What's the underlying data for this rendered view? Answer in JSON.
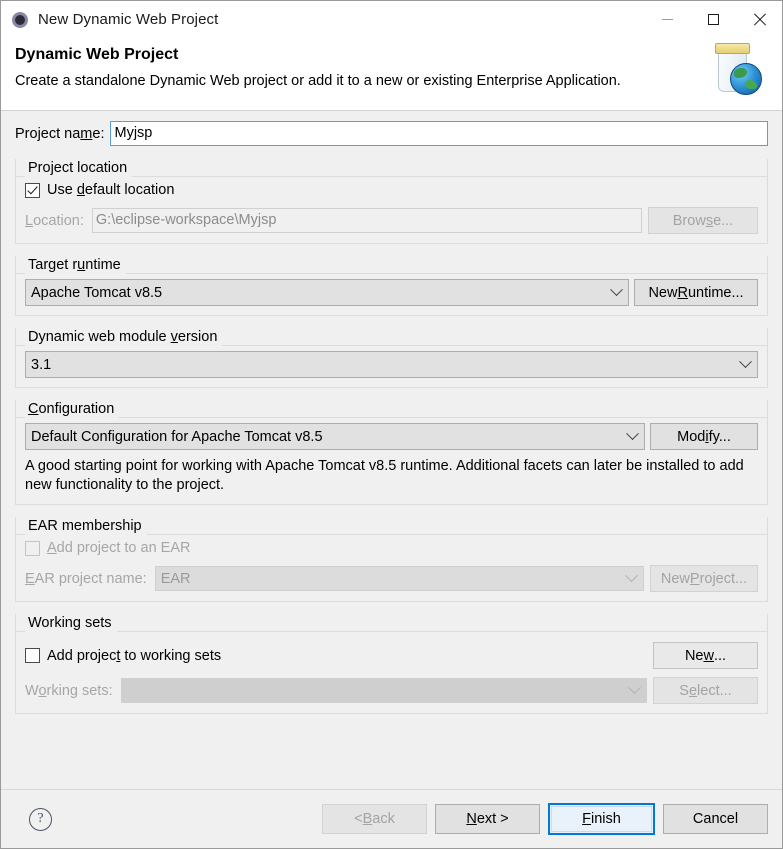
{
  "window": {
    "title": "New Dynamic Web Project",
    "icon": "eclipse-icon",
    "controls": {
      "minimize": "minimize-icon",
      "maximize": "maximize-icon",
      "close": "close-icon"
    }
  },
  "header": {
    "title": "Dynamic Web Project",
    "description": "Create a standalone Dynamic Web project or add it to a new or existing Enterprise Application.",
    "icon": "web-project-jar-globe-icon"
  },
  "form": {
    "project_name": {
      "label_pre": "Project na",
      "label_mnemonic": "m",
      "label_post": "e:",
      "value": "Myjsp"
    },
    "project_location": {
      "group_title": "Project location",
      "use_default": {
        "label_pre": "Use ",
        "label_mnemonic": "d",
        "label_post": "efault location",
        "checked": true
      },
      "location": {
        "label_pre": "L",
        "label_mnemonic": "o",
        "label_post": "cation:",
        "value": "G:\\eclipse-workspace\\Myjsp",
        "enabled": false
      },
      "browse_button": {
        "label_pre": "Brow",
        "label_mnemonic": "s",
        "label_post": "e...",
        "enabled": false
      }
    },
    "target_runtime": {
      "label_pre": "Target r",
      "label_mnemonic": "u",
      "label_post": "ntime",
      "value": "Apache Tomcat v8.5",
      "new_runtime_button": {
        "label_pre": "New ",
        "label_mnemonic": "R",
        "label_post": "untime..."
      }
    },
    "module_version": {
      "label_pre": "Dynamic web module ",
      "label_mnemonic": "v",
      "label_post": "ersion",
      "value": "3.1"
    },
    "configuration": {
      "label_pre": "",
      "label_mnemonic": "C",
      "label_post": "onfiguration",
      "value": "Default Configuration for Apache Tomcat v8.5",
      "modify_button": {
        "label_pre": "Mod",
        "label_mnemonic": "i",
        "label_post": "fy..."
      },
      "description": "A good starting point for working with Apache Tomcat v8.5 runtime. Additional facets can later be installed to add new functionality to the project."
    },
    "ear_membership": {
      "group_title": "EAR membership",
      "add_to_ear": {
        "label_pre": "",
        "label_mnemonic": "A",
        "label_post": "dd project to an EAR",
        "checked": false,
        "enabled": false
      },
      "ear_project_name": {
        "label_pre": "",
        "label_mnemonic": "E",
        "label_post": "AR project name:",
        "value": "EAR",
        "enabled": false
      },
      "new_project_button": {
        "label_pre": "New ",
        "label_mnemonic": "P",
        "label_post": "roject...",
        "enabled": false
      }
    },
    "working_sets": {
      "group_title": "Working sets",
      "add_to_working_sets": {
        "label_pre": "Add projec",
        "label_mnemonic": "t",
        "label_post": " to working sets",
        "checked": false,
        "enabled": true
      },
      "working_sets_field": {
        "label_pre": "W",
        "label_mnemonic": "o",
        "label_post": "rking sets:",
        "value": "",
        "enabled": false
      },
      "new_button": {
        "label_pre": "Ne",
        "label_mnemonic": "w",
        "label_post": "...",
        "enabled": true
      },
      "select_button": {
        "label_pre": "S",
        "label_mnemonic": "e",
        "label_post": "lect...",
        "enabled": false
      }
    }
  },
  "footer": {
    "help": "?",
    "back": {
      "label_pre": "< ",
      "label_mnemonic": "B",
      "label_post": "ack",
      "enabled": false
    },
    "next": {
      "label_pre": "",
      "label_mnemonic": "N",
      "label_post": "ext >",
      "enabled": true
    },
    "finish": {
      "label_pre": "",
      "label_mnemonic": "F",
      "label_post": "inish",
      "enabled": true,
      "focused": true
    },
    "cancel": {
      "label": "Cancel",
      "enabled": true
    }
  },
  "colors": {
    "focus_blue": "#0078d7",
    "input_focus_border": "#5a9fd4",
    "dialog_bg": "#f0f0f0",
    "control_bg": "#e1e1e1",
    "disabled_text": "#a3a3a3"
  }
}
